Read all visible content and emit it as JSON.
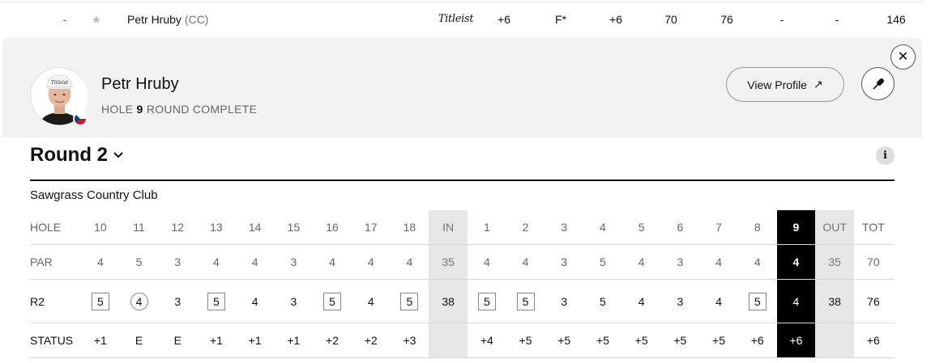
{
  "leaderboard_row": {
    "position": "-",
    "player_name": "Petr Hruby",
    "country_code": "(CC)",
    "brand": "Titleist",
    "total": "+6",
    "thru": "F*",
    "round": "+6",
    "r1": "70",
    "r2": "76",
    "r3": "-",
    "r4": "-",
    "strokes": "146"
  },
  "player": {
    "name": "Petr Hruby",
    "hole_label": "HOLE",
    "hole_number": "9",
    "status": "ROUND COMPLETE"
  },
  "actions": {
    "view_profile": "View Profile",
    "view_profile_arrow": "↗",
    "close": "✕"
  },
  "round": {
    "title": "Round 2",
    "chevron": "⌄",
    "info": "i",
    "course": "Sawgrass Country Club"
  },
  "scorecard": {
    "labels": {
      "hole": "HOLE",
      "par": "PAR",
      "score": "R2",
      "status": "STATUS"
    },
    "columns": [
      {
        "hole": "10",
        "par": "4",
        "score": "5",
        "mark": "bogey",
        "status": "+1"
      },
      {
        "hole": "11",
        "par": "5",
        "score": "4",
        "mark": "birdie",
        "status": "E"
      },
      {
        "hole": "12",
        "par": "3",
        "score": "3",
        "mark": "",
        "status": "E"
      },
      {
        "hole": "13",
        "par": "4",
        "score": "5",
        "mark": "bogey",
        "status": "+1"
      },
      {
        "hole": "14",
        "par": "4",
        "score": "4",
        "mark": "",
        "status": "+1"
      },
      {
        "hole": "15",
        "par": "3",
        "score": "3",
        "mark": "",
        "status": "+1"
      },
      {
        "hole": "16",
        "par": "4",
        "score": "5",
        "mark": "bogey",
        "status": "+2"
      },
      {
        "hole": "17",
        "par": "4",
        "score": "4",
        "mark": "",
        "status": "+2"
      },
      {
        "hole": "18",
        "par": "4",
        "score": "5",
        "mark": "bogey",
        "status": "+3"
      },
      {
        "hole": "IN",
        "par": "35",
        "score": "38",
        "mark": "",
        "status": "",
        "kind": "total"
      },
      {
        "hole": "1",
        "par": "4",
        "score": "5",
        "mark": "bogey",
        "status": "+4"
      },
      {
        "hole": "2",
        "par": "4",
        "score": "5",
        "mark": "bogey",
        "status": "+5"
      },
      {
        "hole": "3",
        "par": "3",
        "score": "3",
        "mark": "",
        "status": "+5"
      },
      {
        "hole": "4",
        "par": "5",
        "score": "5",
        "mark": "",
        "status": "+5"
      },
      {
        "hole": "5",
        "par": "4",
        "score": "4",
        "mark": "",
        "status": "+5"
      },
      {
        "hole": "6",
        "par": "3",
        "score": "3",
        "mark": "",
        "status": "+5"
      },
      {
        "hole": "7",
        "par": "4",
        "score": "4",
        "mark": "",
        "status": "+5"
      },
      {
        "hole": "8",
        "par": "4",
        "score": "5",
        "mark": "bogey",
        "status": "+6"
      },
      {
        "hole": "9",
        "par": "4",
        "score": "4",
        "mark": "",
        "status": "+6",
        "kind": "current"
      },
      {
        "hole": "OUT",
        "par": "35",
        "score": "38",
        "mark": "",
        "status": "",
        "kind": "total"
      },
      {
        "hole": "TOT",
        "par": "70",
        "score": "76",
        "mark": "",
        "status": "+6",
        "kind": "grand"
      }
    ]
  },
  "colors": {
    "panel_bg": "#f2f2f2",
    "current_hole_bg": "#000000",
    "subtotal_bg": "#e6e6e6",
    "flag_white": "#ffffff",
    "flag_red": "#d7141a",
    "flag_blue": "#11457e"
  }
}
